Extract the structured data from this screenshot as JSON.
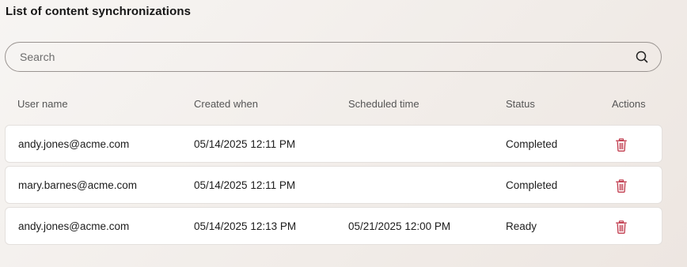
{
  "page": {
    "title": "List of content synchronizations"
  },
  "search": {
    "placeholder": "Search",
    "value": ""
  },
  "table": {
    "columns": [
      "User name",
      "Created when",
      "Scheduled time",
      "Status",
      "Actions"
    ],
    "rows": [
      {
        "user": "andy.jones@acme.com",
        "created": "05/14/2025 12:11 PM",
        "scheduled": "",
        "status": "Completed",
        "action_icon": "trash-icon"
      },
      {
        "user": "mary.barnes@acme.com",
        "created": "05/14/2025 12:11 PM",
        "scheduled": "",
        "status": "Completed",
        "action_icon": "trash-icon"
      },
      {
        "user": "andy.jones@acme.com",
        "created": "05/14/2025 12:13 PM",
        "scheduled": "05/21/2025 12:00 PM",
        "status": "Ready",
        "action_icon": "trash-icon"
      }
    ]
  },
  "colors": {
    "delete_icon": "#c0394b",
    "row_background": "#ffffff",
    "search_border": "#9a9491"
  }
}
